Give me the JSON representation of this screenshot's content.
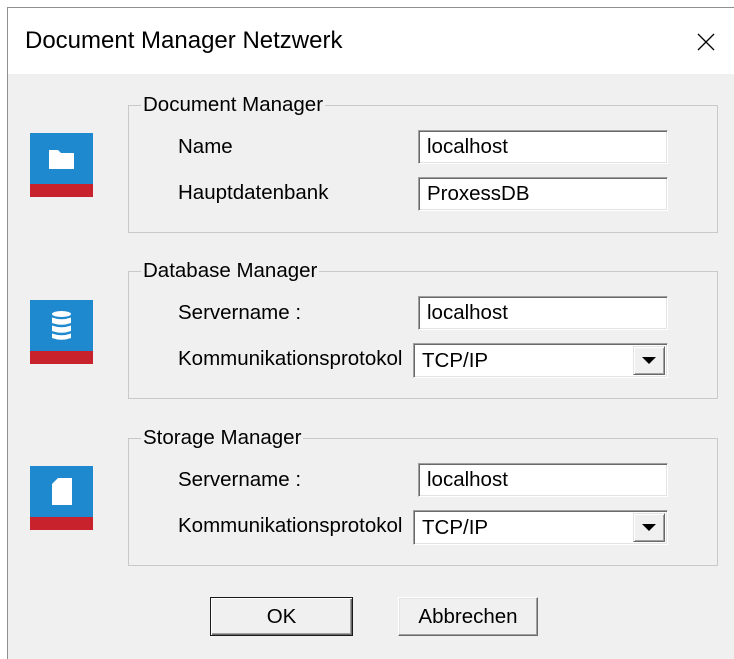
{
  "window": {
    "title": "Document Manager Netzwerk",
    "close_icon": "close-icon"
  },
  "groups": [
    {
      "legend": "Document Manager",
      "icon": "folder-icon",
      "rows": [
        {
          "label": "Name",
          "type": "text",
          "value": "localhost"
        },
        {
          "label": "Hauptdatenbank",
          "type": "text",
          "value": "ProxessDB"
        }
      ]
    },
    {
      "legend": "Database Manager",
      "icon": "database-icon",
      "rows": [
        {
          "label": "Servername :",
          "type": "text",
          "value": "localhost"
        },
        {
          "label": "Kommunikationsprotokol",
          "type": "select",
          "value": "TCP/IP",
          "dropdown_icon": "chevron-down-icon"
        }
      ]
    },
    {
      "legend": "Storage Manager",
      "icon": "document-icon",
      "rows": [
        {
          "label": "Servername :",
          "type": "text",
          "value": "localhost"
        },
        {
          "label": "Kommunikationsprotokol",
          "type": "select",
          "value": "TCP/IP",
          "dropdown_icon": "chevron-down-icon"
        }
      ]
    }
  ],
  "buttons": {
    "ok": "OK",
    "cancel": "Abbrechen"
  },
  "theme": {
    "icon_tile_blue": "#1f89d0",
    "icon_tile_red": "#c8232d",
    "dialog_background": "#f0f0f0"
  }
}
